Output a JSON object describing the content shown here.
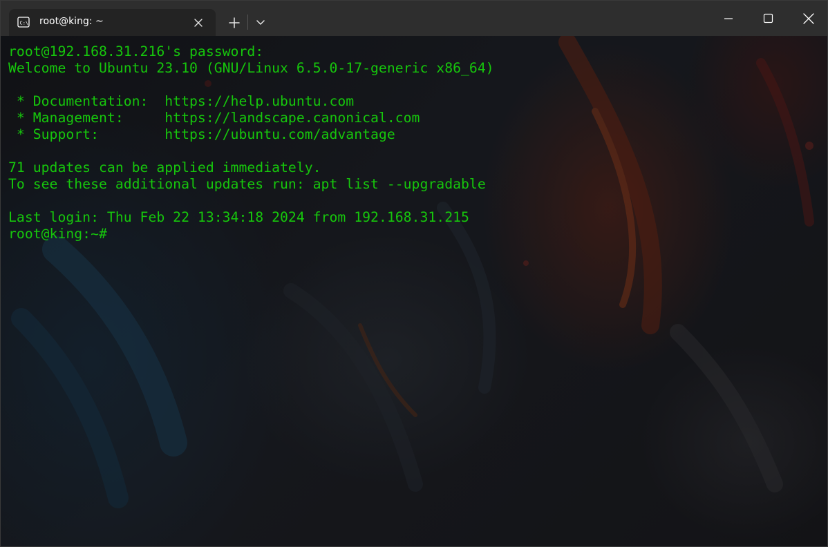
{
  "window": {
    "tab_title": "root@king: ~",
    "icons": {
      "tab": "terminal-icon",
      "close_tab": "close-icon",
      "new_tab": "plus-icon",
      "dropdown": "chevron-down-icon",
      "minimize": "minimize-icon",
      "maximize": "maximize-icon",
      "close_window": "close-icon"
    }
  },
  "colors": {
    "terminal_text": "#16c60c",
    "titlebar": "#2e2e2e",
    "tab": "#232323"
  },
  "terminal": {
    "lines": [
      "root@192.168.31.216's password:",
      "Welcome to Ubuntu 23.10 (GNU/Linux 6.5.0-17-generic x86_64)",
      "",
      " * Documentation:  https://help.ubuntu.com",
      " * Management:     https://landscape.canonical.com",
      " * Support:        https://ubuntu.com/advantage",
      "",
      "71 updates can be applied immediately.",
      "To see these additional updates run: apt list --upgradable",
      "",
      "Last login: Thu Feb 22 13:34:18 2024 from 192.168.31.215",
      "root@king:~#"
    ]
  }
}
